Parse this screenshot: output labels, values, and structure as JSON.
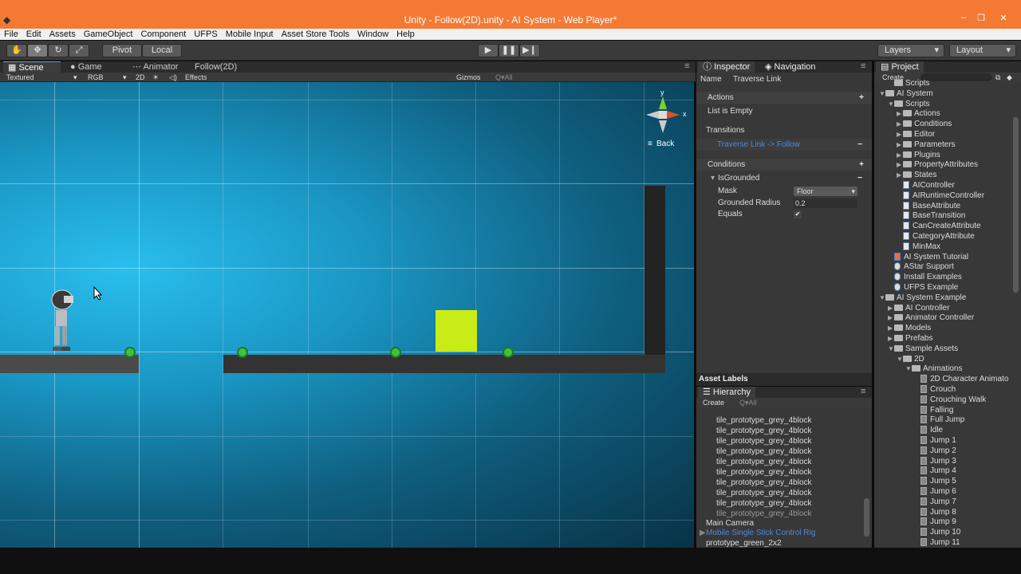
{
  "window": {
    "title": "Unity - Follow(2D).unity - AI System - Web Player*",
    "minimize": "–",
    "maximize": "❐",
    "close": "✕"
  },
  "menu": [
    "File",
    "Edit",
    "Assets",
    "GameObject",
    "Component",
    "UFPS",
    "Mobile Input",
    "Asset Store Tools",
    "Window",
    "Help"
  ],
  "toolbar": {
    "pivot": "Pivot",
    "local": "Local",
    "layers": "Layers",
    "layout": "Layout",
    "play": "▶",
    "pause": "❚❚",
    "step": "▶❙"
  },
  "scene_tabs": {
    "scene": "Scene",
    "game": "Game",
    "animator": "Animator",
    "follow": "Follow(2D)"
  },
  "scene_bar": {
    "mode": "Textured",
    "rgb": "RGB",
    "two_d": "2D",
    "effects": "Effects",
    "gizmos": "Gizmos",
    "search_placeholder": "Q▾All"
  },
  "gizmo": {
    "y": "y",
    "x": "x",
    "back": "Back"
  },
  "inspector": {
    "tab": "Inspector",
    "nav_tab": "Navigation",
    "name_label": "Name",
    "name_value": "Traverse Link",
    "actions": "Actions",
    "list_empty": "List is Empty",
    "transitions": "Transitions",
    "transition_item": "Traverse Link -> Follow",
    "conditions": "Conditions",
    "is_grounded": "IsGrounded",
    "mask_label": "Mask",
    "mask_value": "Floor",
    "radius_label": "Grounded Radius",
    "radius_value": "0.2",
    "equals_label": "Equals",
    "equals_checked": "✔"
  },
  "asset_labels": "Asset Labels",
  "hierarchy": {
    "tab": "Hierarchy",
    "create": "Create",
    "search_placeholder": "Q▾All",
    "items": [
      "tile_prototype_grey_4block",
      "tile_prototype_grey_4block",
      "tile_prototype_grey_4block",
      "tile_prototype_grey_4block",
      "tile_prototype_grey_4block",
      "tile_prototype_grey_4block",
      "tile_prototype_grey_4block",
      "tile_prototype_grey_4block",
      "tile_prototype_grey_4block",
      "tile_prototype_grey_4block"
    ],
    "main_camera": "Main Camera",
    "mobile_rig": "Mobile Single Stick Control Rig",
    "prototype": "prototype_green_2x2"
  },
  "project": {
    "tab": "Project",
    "create": "Create",
    "items": [
      {
        "label": "Scripts",
        "kind": "folder",
        "indent": 1,
        "arrow": ""
      },
      {
        "label": "AI System",
        "kind": "folder",
        "indent": 0,
        "arrow": "▼"
      },
      {
        "label": "Scripts",
        "kind": "folder",
        "indent": 1,
        "arrow": "▼"
      },
      {
        "label": "Actions",
        "kind": "folder",
        "indent": 2,
        "arrow": "▶"
      },
      {
        "label": "Conditions",
        "kind": "folder",
        "indent": 2,
        "arrow": "▶"
      },
      {
        "label": "Editor",
        "kind": "folder",
        "indent": 2,
        "arrow": "▶"
      },
      {
        "label": "Parameters",
        "kind": "folder",
        "indent": 2,
        "arrow": "▶"
      },
      {
        "label": "Plugins",
        "kind": "folder",
        "indent": 2,
        "arrow": "▶"
      },
      {
        "label": "PropertyAttributes",
        "kind": "folder",
        "indent": 2,
        "arrow": "▶"
      },
      {
        "label": "States",
        "kind": "folder",
        "indent": 2,
        "arrow": "▶"
      },
      {
        "label": "AIController",
        "kind": "script",
        "indent": 2,
        "arrow": ""
      },
      {
        "label": "AIRuntimeController",
        "kind": "script",
        "indent": 2,
        "arrow": ""
      },
      {
        "label": "BaseAttribute",
        "kind": "script",
        "indent": 2,
        "arrow": ""
      },
      {
        "label": "BaseTransition",
        "kind": "script",
        "indent": 2,
        "arrow": ""
      },
      {
        "label": "CanCreateAttribute",
        "kind": "script",
        "indent": 2,
        "arrow": ""
      },
      {
        "label": "CategoryAttribute",
        "kind": "script",
        "indent": 2,
        "arrow": ""
      },
      {
        "label": "MinMax",
        "kind": "script",
        "indent": 2,
        "arrow": ""
      },
      {
        "label": "AI System Tutorial",
        "kind": "doc",
        "indent": 1,
        "arrow": ""
      },
      {
        "label": "AStar Support",
        "kind": "pkg",
        "indent": 1,
        "arrow": ""
      },
      {
        "label": "Install Examples",
        "kind": "pkg",
        "indent": 1,
        "arrow": ""
      },
      {
        "label": "UFPS Example",
        "kind": "pkg",
        "indent": 1,
        "arrow": ""
      },
      {
        "label": "AI System Example",
        "kind": "folder",
        "indent": 0,
        "arrow": "▼"
      },
      {
        "label": "AI Controller",
        "kind": "folder",
        "indent": 1,
        "arrow": "▶"
      },
      {
        "label": "Animator Controller",
        "kind": "folder",
        "indent": 1,
        "arrow": "▶"
      },
      {
        "label": "Models",
        "kind": "folder",
        "indent": 1,
        "arrow": "▶"
      },
      {
        "label": "Prefabs",
        "kind": "folder",
        "indent": 1,
        "arrow": "▶"
      },
      {
        "label": "Sample Assets",
        "kind": "folder",
        "indent": 1,
        "arrow": "▼"
      },
      {
        "label": "2D",
        "kind": "folder",
        "indent": 2,
        "arrow": "▼"
      },
      {
        "label": "Animations",
        "kind": "folder",
        "indent": 3,
        "arrow": "▼"
      },
      {
        "label": "2D Character Animato",
        "kind": "anim",
        "indent": 4,
        "arrow": ""
      },
      {
        "label": "Crouch",
        "kind": "anim",
        "indent": 4,
        "arrow": ""
      },
      {
        "label": "Crouching Walk",
        "kind": "anim",
        "indent": 4,
        "arrow": ""
      },
      {
        "label": "Falling",
        "kind": "anim",
        "indent": 4,
        "arrow": ""
      },
      {
        "label": "Full Jump",
        "kind": "anim",
        "indent": 4,
        "arrow": ""
      },
      {
        "label": "Idle",
        "kind": "anim",
        "indent": 4,
        "arrow": ""
      },
      {
        "label": "Jump 1",
        "kind": "anim",
        "indent": 4,
        "arrow": ""
      },
      {
        "label": "Jump 2",
        "kind": "anim",
        "indent": 4,
        "arrow": ""
      },
      {
        "label": "Jump 3",
        "kind": "anim",
        "indent": 4,
        "arrow": ""
      },
      {
        "label": "Jump 4",
        "kind": "anim",
        "indent": 4,
        "arrow": ""
      },
      {
        "label": "Jump 5",
        "kind": "anim",
        "indent": 4,
        "arrow": ""
      },
      {
        "label": "Jump 6",
        "kind": "anim",
        "indent": 4,
        "arrow": ""
      },
      {
        "label": "Jump 7",
        "kind": "anim",
        "indent": 4,
        "arrow": ""
      },
      {
        "label": "Jump 8",
        "kind": "anim",
        "indent": 4,
        "arrow": ""
      },
      {
        "label": "Jump 9",
        "kind": "anim",
        "indent": 4,
        "arrow": ""
      },
      {
        "label": "Jump 10",
        "kind": "anim",
        "indent": 4,
        "arrow": ""
      },
      {
        "label": "Jump 11",
        "kind": "anim",
        "indent": 4,
        "arrow": ""
      }
    ]
  },
  "colors": {
    "titlebar": "#f47a34",
    "scene_sky": "#1a96c4",
    "waypoint": "#3ec33e",
    "target_box": "#c9ec16",
    "link_blue": "#4f8ad8"
  }
}
